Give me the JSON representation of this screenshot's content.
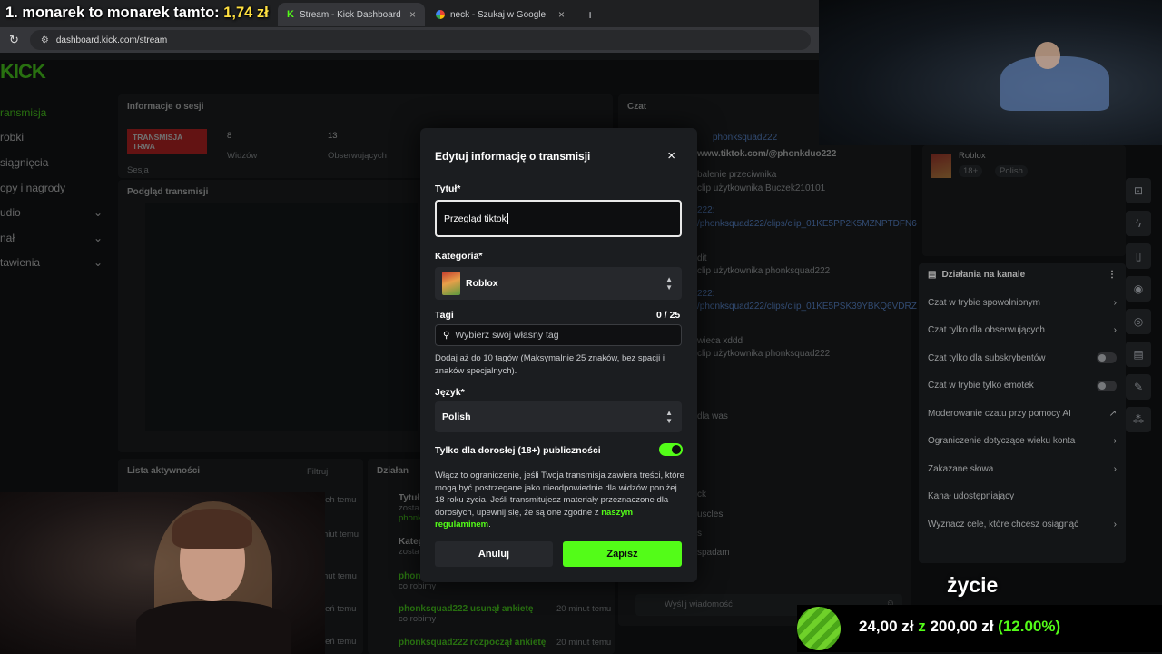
{
  "stream_overlay": {
    "title_prefix": "1. monarek to monarek tamto:",
    "title_value": "1,74 zł",
    "bottom_word": "życie",
    "goal_current": "24,00 zł",
    "goal_sep": "z",
    "goal_target": "200,00 zł",
    "goal_percent": "(12.00%)",
    "goal_progress": 0.12
  },
  "browser": {
    "tabs": [
      {
        "label": "Stream - Kick Dashboard",
        "icon": "kick-logo-icon",
        "active": true
      },
      {
        "label": "neck - Szukaj w Google",
        "icon": "google-icon",
        "active": false
      }
    ],
    "new_tab": "+",
    "url": "dashboard.kick.com/stream"
  },
  "sidebar": {
    "logo": "KICK",
    "items": [
      "ransmisja",
      "robki",
      "siągnięcia",
      "opy i nagrody",
      "udio",
      "nał",
      "tawienia"
    ]
  },
  "session_panel": {
    "title": "Informacje o sesji",
    "status": "TRANSMISJA TRWA",
    "session_label": "Sesja",
    "viewers_count": "8",
    "viewers_label": "Widzów",
    "followers_count": "13",
    "followers_label": "Obserwujących"
  },
  "preview_panel": {
    "title": "Podgląd transmisji"
  },
  "activity_panel": {
    "title": "Lista aktywności",
    "filter": "Filtruj"
  },
  "actions_panel_bottom": {
    "title": "Działan",
    "rows": [
      {
        "title": "Tytuł",
        "sub": "zosta",
        "sub2": "phonk"
      },
      {
        "title": "Kateg",
        "sub": "zosta"
      },
      {
        "title": "phonk",
        "sub": "co robimy",
        "time": "nut temu"
      },
      {
        "title": "phonksquad222 usunął ankietę",
        "sub": "co robimy",
        "time": "20 minut temu"
      },
      {
        "title": "phonksquad222 rozpoczął ankietę",
        "time": "20 minut temu"
      }
    ],
    "times": [
      "ieh temu",
      "niut temu",
      "nut temu",
      "leń temu",
      "ień temu"
    ]
  },
  "chat": {
    "title": "Czat",
    "lines": [
      "phonksquad222",
      "www.tiktok.com/@phonkduo222",
      "balenie przeciwnika",
      "clip użytkownika Buczek210101",
      "222:",
      "/phonksquad222/clips/clip_01KE5PP2K5MZNPTDFN6",
      "dit",
      "clip użytkownika phonksquad222",
      "222:",
      "/phonksquad222/clips/clip_01KE5PSK39YBKQ6VDRZ",
      "wieca xddd",
      "clip użytkownika phonksquad222",
      "dla was",
      "ck",
      "uscles",
      "s",
      "spadam"
    ],
    "placeholder": "Wyślij wiadomość"
  },
  "stream_info_card": {
    "category": "Roblox",
    "tag_age": "18+",
    "tag_lang": "Polish"
  },
  "channel_actions": {
    "title": "Działania na kanale",
    "items": [
      {
        "label": "Czat w trybie spowolnionym",
        "control": "chevron"
      },
      {
        "label": "Czat tylko dla obserwujących",
        "control": "chevron"
      },
      {
        "label": "Czat tylko dla subskrybentów",
        "control": "toggle"
      },
      {
        "label": "Czat w trybie tylko emotek",
        "control": "toggle"
      },
      {
        "label": "Moderowanie czatu przy pomocy AI",
        "control": "external"
      },
      {
        "label": "Ograniczenie dotyczące wieku konta",
        "control": "chevron"
      },
      {
        "label": "Zakazane słowa",
        "control": "chevron"
      },
      {
        "label": "Kanał udostępniający",
        "control": "none"
      },
      {
        "label": "Wyznacz cele, które chcesz osiągnąć",
        "control": "chevron"
      }
    ]
  },
  "modal": {
    "title": "Edytuj informację o transmisji",
    "close": "×",
    "title_label": "Tytuł*",
    "title_value": "Przegląd tiktok",
    "category_label": "Kategoria*",
    "category_value": "Roblox",
    "tags_label": "Tagi",
    "tags_count": "0 / 25",
    "tags_placeholder": "Wybierz swój własny tag",
    "tags_help": "Dodaj aż do 10 tagów (Maksymalnie 25 znaków, bez spacji i znaków specjalnych).",
    "language_label": "Język*",
    "language_value": "Polish",
    "adult_label": "Tylko dla dorosłej (18+) publiczności",
    "adult_enabled": true,
    "adult_help": "Włącz to ograniczenie, jeśli Twoja transmisja zawiera treści, które mogą być postrzegane jako nieodpowiednie dla widzów poniżej 18 roku życia. Jeśli transmitujesz materiały przeznaczone dla dorosłych, upewnij się, że są one zgodne z",
    "adult_help_link": "naszym regulaminem",
    "adult_help_end": ".",
    "cancel": "Anuluj",
    "save": "Zapisz"
  },
  "colors": {
    "accent": "#53fc18",
    "modal_bg": "#1b1d20",
    "page_bg": "#0a0b0c",
    "live_red": "#e0201f"
  }
}
